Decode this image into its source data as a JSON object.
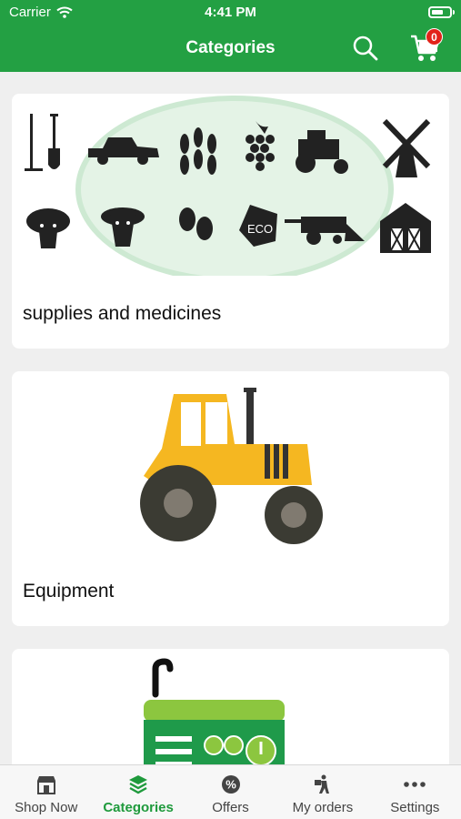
{
  "status_bar": {
    "carrier": "Carrier",
    "time": "4:41 PM"
  },
  "nav": {
    "title": "Categories",
    "cart_count": "0"
  },
  "categories": [
    {
      "label": "supplies and medicines"
    },
    {
      "label": "Equipment"
    },
    {
      "label": ""
    }
  ],
  "tabs": [
    {
      "label": "Shop Now",
      "icon": "store-icon"
    },
    {
      "label": "Categories",
      "icon": "layers-icon"
    },
    {
      "label": "Offers",
      "icon": "percent-icon"
    },
    {
      "label": "My orders",
      "icon": "delivery-icon"
    },
    {
      "label": "Settings",
      "icon": "more-dots-icon"
    }
  ],
  "colors": {
    "primary": "#23a043",
    "badge": "#e2231a",
    "tractor_yellow": "#f5b721",
    "generator_green": "#8cc63f"
  }
}
